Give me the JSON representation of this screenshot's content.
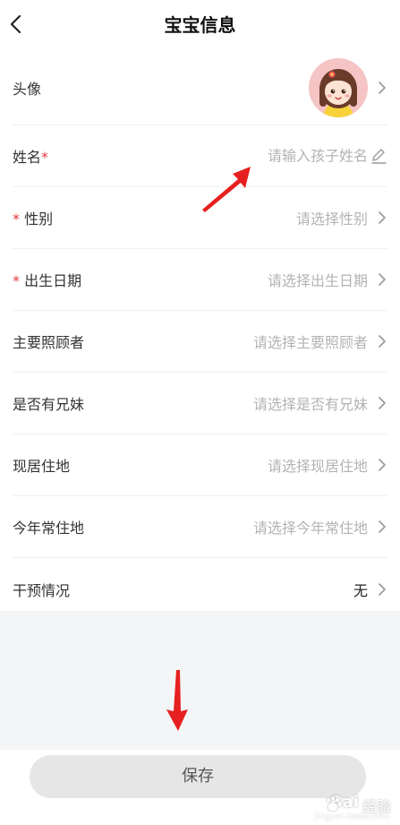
{
  "header": {
    "title": "宝宝信息"
  },
  "form": {
    "avatar_label": "头像",
    "name": {
      "label": "姓名",
      "required_mark": "*",
      "placeholder": "请输入孩子姓名"
    },
    "rows": [
      {
        "label": "性别",
        "required_mark": "*",
        "value": "请选择性别"
      },
      {
        "label": "出生日期",
        "required_mark": "*",
        "value": "请选择出生日期"
      },
      {
        "label": "主要照顾者",
        "value": "请选择主要照顾者"
      },
      {
        "label": "是否有兄妹",
        "value": "请选择是否有兄妹"
      },
      {
        "label": "现居住地",
        "value": "请选择现居住地"
      },
      {
        "label": "今年常住地",
        "value": "请选择今年常住地"
      },
      {
        "label": "干预情况",
        "value": "无"
      }
    ]
  },
  "footer": {
    "save_label": "保存"
  },
  "watermark": {
    "brand": "Bai",
    "brand_cn": "经验",
    "url": "jingyan.baidu.com"
  },
  "colors": {
    "required": "#e23b3b",
    "placeholder": "#b3b3b3",
    "annotation_arrow": "#e62020",
    "save_button_bg": "#e6e6e6",
    "page_grey": "#f4f5f7"
  },
  "icons": [
    "back-arrow-icon",
    "chevron-right-icon",
    "pencil-icon",
    "avatar-girl-image",
    "baidu-paw-icon"
  ]
}
